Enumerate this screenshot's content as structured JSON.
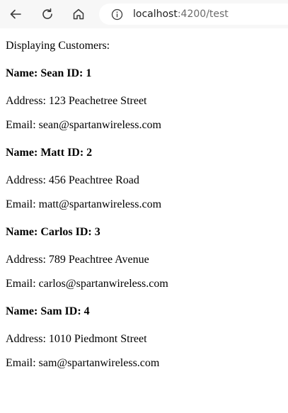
{
  "browser": {
    "url_host": "localhost",
    "url_rest": ":4200/test",
    "icons": {
      "back": "back-arrow-icon",
      "reload": "reload-icon",
      "home": "home-icon",
      "info": "info-icon"
    }
  },
  "page": {
    "intro": "Displaying Customers:",
    "customers": [
      {
        "header": "Name: Sean ID: 1",
        "address": "Address: 123 Peachetree Street",
        "email": "Email: sean@spartanwireless.com"
      },
      {
        "header": "Name: Matt ID: 2",
        "address": "Address: 456 Peachtree Road",
        "email": "Email: matt@spartanwireless.com"
      },
      {
        "header": "Name: Carlos ID: 3",
        "address": "Address: 789 Peachtree Avenue",
        "email": "Email: carlos@spartanwireless.com"
      },
      {
        "header": "Name: Sam ID: 4",
        "address": "Address: 1010 Piedmont Street",
        "email": "Email: sam@spartanwireless.com"
      }
    ]
  }
}
